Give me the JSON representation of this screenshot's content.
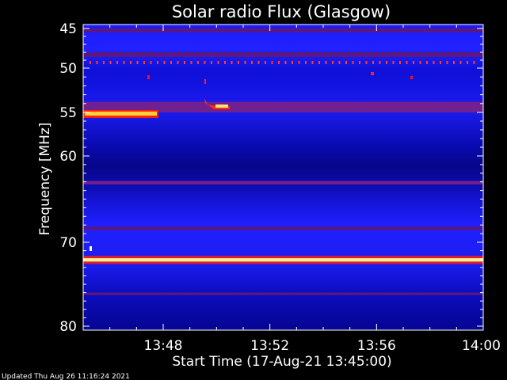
{
  "chart_data": {
    "type": "heatmap",
    "title": "Solar radio Flux (Glasgow)",
    "xlabel": "Start Time (17-Aug-21 13:45:00)",
    "ylabel": "Frequency [MHz]",
    "x_ticks": [
      "13:48",
      "13:52",
      "13:56",
      "14:00"
    ],
    "y_ticks": [
      "45",
      "50",
      "55",
      "60",
      "70",
      "80"
    ],
    "footer": "Updated Thu Aug 26 11:16:24 2021",
    "colors": {
      "background": "#000000",
      "low": "#000080",
      "mid": "#1a1aff",
      "high": "#ff0000",
      "peak": "#ffff80"
    },
    "bands": [
      {
        "freq_start": 45.0,
        "freq_end": 45.5,
        "intensity": 0.4
      },
      {
        "freq_start": 48.0,
        "freq_end": 48.6,
        "intensity": 0.45
      },
      {
        "freq_start": 53.8,
        "freq_end": 55.0,
        "intensity": 0.5
      },
      {
        "freq_start": 62.9,
        "freq_end": 63.3,
        "intensity": 0.5
      },
      {
        "freq_start": 68.2,
        "freq_end": 68.6,
        "intensity": 0.45
      },
      {
        "freq_start": 71.9,
        "freq_end": 72.3,
        "intensity": 1.0
      },
      {
        "freq_start": 76.0,
        "freq_end": 76.3,
        "intensity": 0.35
      }
    ]
  }
}
